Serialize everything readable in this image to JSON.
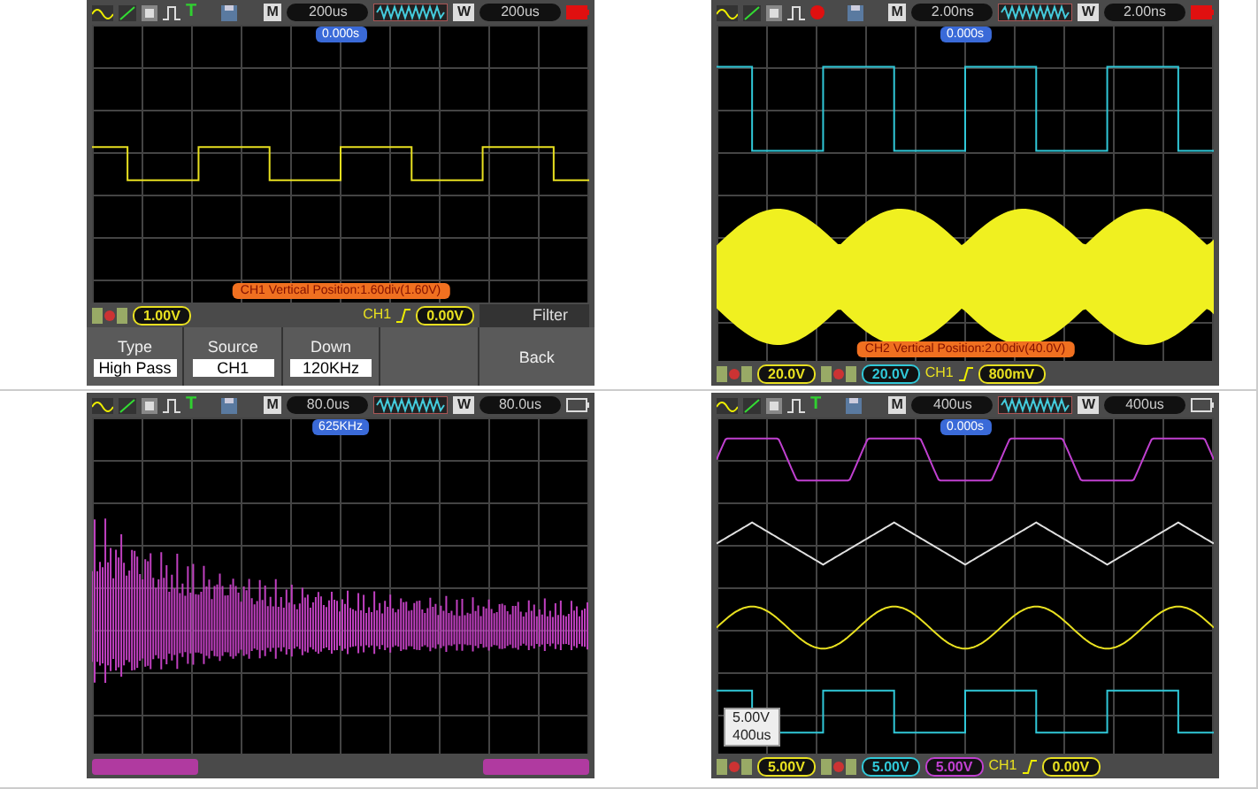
{
  "panels": [
    {
      "header": {
        "trigger": {
          "kind": "letter",
          "text": "T"
        },
        "m_label": "M",
        "m_time": "200us",
        "w_label": "W",
        "w_time": "200us",
        "battery_low": true
      },
      "marker": "0.000s",
      "waveforms": [
        {
          "kind": "square",
          "color": "#e8e020"
        }
      ],
      "message": "CH1 Vertical Position:1.60div(1.60V)",
      "footer": [
        {
          "kind": "icons"
        },
        {
          "kind": "readout",
          "text": "1.00V",
          "color": "#e8e020"
        },
        {
          "kind": "spacer"
        },
        {
          "kind": "label",
          "text": "CH1",
          "color": "#e8e020"
        },
        {
          "kind": "edge"
        },
        {
          "kind": "readout",
          "text": "0.00V",
          "color": "#e8e020"
        }
      ],
      "menu": {
        "title": "Filter",
        "options": [
          {
            "label": "Type",
            "value": "High Pass"
          },
          {
            "label": "Source",
            "value": "CH1"
          },
          {
            "label": "Down",
            "value": "120KHz"
          }
        ],
        "back": "Back"
      }
    },
    {
      "header": {
        "trigger": {
          "kind": "dot"
        },
        "m_label": "M",
        "m_time": "2.00ns",
        "w_label": "W",
        "w_time": "2.00ns",
        "battery_low": true
      },
      "marker": "0.000s",
      "waveforms": [
        {
          "kind": "square",
          "color": "#30c8d8"
        },
        {
          "kind": "am",
          "color": "#f0f020"
        }
      ],
      "message": "CH2 Vertical Position:2.00div(40.0V)",
      "footer": [
        {
          "kind": "icons"
        },
        {
          "kind": "readout",
          "text": "20.0V",
          "color": "#e8e020"
        },
        {
          "kind": "icons"
        },
        {
          "kind": "readout",
          "text": "20.0V",
          "color": "#30c8d8"
        },
        {
          "kind": "label",
          "text": "CH1",
          "color": "#e8e020"
        },
        {
          "kind": "edge"
        },
        {
          "kind": "readout",
          "text": "800mV",
          "color": "#e8e020"
        }
      ]
    },
    {
      "header": {
        "trigger": {
          "kind": "letter",
          "text": "T"
        },
        "m_label": "M",
        "m_time": "80.0us",
        "w_label": "W",
        "w_time": "80.0us",
        "battery_low": false
      },
      "marker": "625KHz",
      "waveforms": [
        {
          "kind": "spectrum",
          "color": "#c040c0"
        }
      ],
      "footer": [
        {
          "kind": "tag"
        },
        {
          "kind": "spacer"
        },
        {
          "kind": "tag"
        }
      ]
    },
    {
      "header": {
        "trigger": {
          "kind": "letter",
          "text": "T"
        },
        "m_label": "M",
        "m_time": "400us",
        "w_label": "W",
        "w_time": "400us",
        "battery_low": false
      },
      "marker": "0.000s",
      "waveforms": [
        {
          "kind": "rounded",
          "color": "#c040d0"
        },
        {
          "kind": "triangle",
          "color": "#e0e0e0"
        },
        {
          "kind": "sine",
          "color": "#e8e020"
        },
        {
          "kind": "square",
          "color": "#30c8d8"
        }
      ],
      "info": [
        "5.00V",
        "400us"
      ],
      "footer": [
        {
          "kind": "icons"
        },
        {
          "kind": "readout",
          "text": "5.00V",
          "color": "#e8e020"
        },
        {
          "kind": "icons"
        },
        {
          "kind": "readout",
          "text": "5.00V",
          "color": "#30c8d8"
        },
        {
          "kind": "readout",
          "text": "5.00V",
          "color": "#c040d0"
        },
        {
          "kind": "label",
          "text": "CH1",
          "color": "#e8e020"
        },
        {
          "kind": "edge"
        },
        {
          "kind": "readout",
          "text": "0.00V",
          "color": "#e8e020"
        }
      ]
    }
  ]
}
